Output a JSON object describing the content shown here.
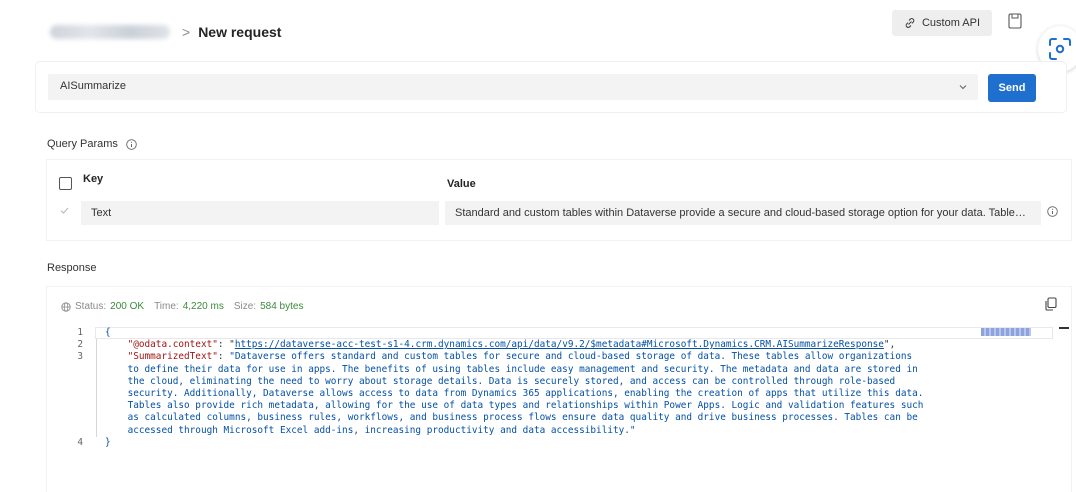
{
  "header": {
    "page_title": "New request",
    "crumb_separator": ">",
    "custom_api_label": "Custom API"
  },
  "request": {
    "endpoint": "AISummarize",
    "send_label": "Send"
  },
  "query_params": {
    "label": "Query Params",
    "columns": {
      "key": "Key",
      "value": "Value"
    },
    "rows": [
      {
        "key": "Text",
        "value": "Standard and custom tables within Dataverse provide a secure and cloud-based storage option for your data. Tables le..."
      }
    ]
  },
  "response": {
    "label": "Response",
    "status_label": "Status:",
    "status_value": "200 OK",
    "time_label": "Time:",
    "time_value": "4,220 ms",
    "size_label": "Size:",
    "size_value": "584 bytes",
    "code": {
      "line_numbers": [
        "1",
        "2",
        "3",
        "4"
      ],
      "open_brace": "{",
      "close_brace": "}",
      "context_key": "\"@odata.context\"",
      "context_value": "https://dataverse-acc-test-s1-4.crm.dynamics.com/api/data/v9.2/$metadata#Microsoft.Dynamics.CRM.AISummarizeResponse",
      "summary_key": "\"SummarizedText\"",
      "summary_lines": [
        "\"Dataverse offers standard and custom tables for secure and cloud-based storage of data. These tables allow organizations",
        "to define their data for use in apps. The benefits of using tables include easy management and security. The metadata and data are stored in",
        "the cloud, eliminating the need to worry about storage details. Data is securely stored, and access can be controlled through role-based",
        "security. Additionally, Dataverse allows access to data from Dynamics 365 applications, enabling the creation of apps that utilize this data.",
        "Tables also provide rich metadata, allowing for the use of data types and relationships within Power Apps. Logic and validation features such",
        "as calculated columns, business rules, workflows, and business process flows ensure data quality and drive business processes. Tables can be",
        "accessed through Microsoft Excel add-ins, increasing productivity and data accessibility.\""
      ]
    }
  },
  "colors": {
    "send_button": "#1f6fce",
    "status_ok": "#3b8a3b",
    "json_key": "#a31515",
    "json_string": "#0451a5"
  },
  "icons": {
    "custom_api": "link-icon",
    "save": "save-icon",
    "lens": "visual-search-icon",
    "dropdown": "chevron-down-icon",
    "info": "info-icon",
    "status": "globe-icon",
    "copy": "copy-icon",
    "row_checkbox": "checkmark-icon"
  }
}
